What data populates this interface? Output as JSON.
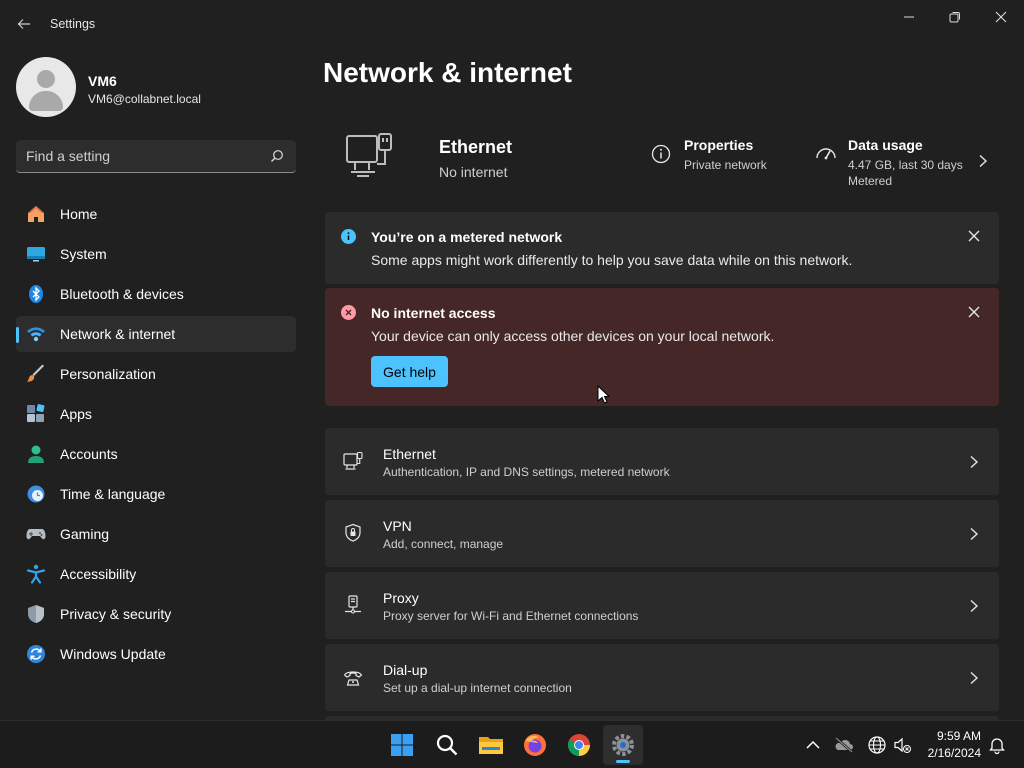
{
  "window": {
    "title": "Settings",
    "controls": [
      "minimize-icon",
      "restore-icon",
      "close-icon"
    ]
  },
  "profile": {
    "name": "VM6",
    "email": "VM6@collabnet.local"
  },
  "search": {
    "placeholder": "Find a setting",
    "value": ""
  },
  "sidebar": {
    "items": [
      {
        "label": "Home",
        "icon": "home-icon",
        "active": false
      },
      {
        "label": "System",
        "icon": "monitor-icon",
        "active": false
      },
      {
        "label": "Bluetooth & devices",
        "icon": "bluetooth-icon",
        "active": false
      },
      {
        "label": "Network & internet",
        "icon": "wifi-icon",
        "active": true
      },
      {
        "label": "Personalization",
        "icon": "brush-icon",
        "active": false
      },
      {
        "label": "Apps",
        "icon": "apps-icon",
        "active": false
      },
      {
        "label": "Accounts",
        "icon": "person-icon",
        "active": false
      },
      {
        "label": "Time & language",
        "icon": "clock-globe-icon",
        "active": false
      },
      {
        "label": "Gaming",
        "icon": "gamepad-icon",
        "active": false
      },
      {
        "label": "Accessibility",
        "icon": "accessibility-icon",
        "active": false
      },
      {
        "label": "Privacy & security",
        "icon": "shield-icon",
        "active": false
      },
      {
        "label": "Windows Update",
        "icon": "refresh-icon",
        "active": false
      }
    ]
  },
  "main": {
    "title": "Network & internet",
    "connection": {
      "name": "Ethernet",
      "status": "No internet"
    },
    "properties": {
      "title": "Properties",
      "subtitle": "Private network"
    },
    "data_usage": {
      "title": "Data usage",
      "line1": "4.47 GB, last 30 days",
      "line2": "Metered"
    },
    "metered_bar": {
      "title": "You’re on a metered network",
      "message": "Some apps might work differently to help you save data while on this network."
    },
    "error_bar": {
      "title": "No internet access",
      "message": "Your device can only access other devices on your local network.",
      "button": "Get help"
    },
    "settings_rows": [
      {
        "title": "Ethernet",
        "subtitle": "Authentication, IP and DNS settings, metered network",
        "icon": "ethernet-icon"
      },
      {
        "title": "VPN",
        "subtitle": "Add, connect, manage",
        "icon": "vpn-shield-icon"
      },
      {
        "title": "Proxy",
        "subtitle": "Proxy server for Wi-Fi and Ethernet connections",
        "icon": "proxy-icon"
      },
      {
        "title": "Dial-up",
        "subtitle": "Set up a dial-up internet connection",
        "icon": "dialup-icon"
      }
    ]
  },
  "taskbar": {
    "apps": [
      "start-icon",
      "search-icon",
      "file-explorer-icon",
      "firefox-icon",
      "chrome-icon",
      "settings-icon"
    ],
    "tray": [
      "chevron-up-icon",
      "onedrive-icon",
      "globe-icon",
      "volume-muted-icon",
      "notification-bell-icon"
    ],
    "time": "9:59 AM",
    "date": "2/16/2024"
  },
  "colors": {
    "accent": "#4cc2ff",
    "background": "#202020",
    "card": "#2b2b2b",
    "error_bar": "#442726",
    "error_icon": "#ff99a4",
    "info_icon": "#4cc2ff"
  }
}
